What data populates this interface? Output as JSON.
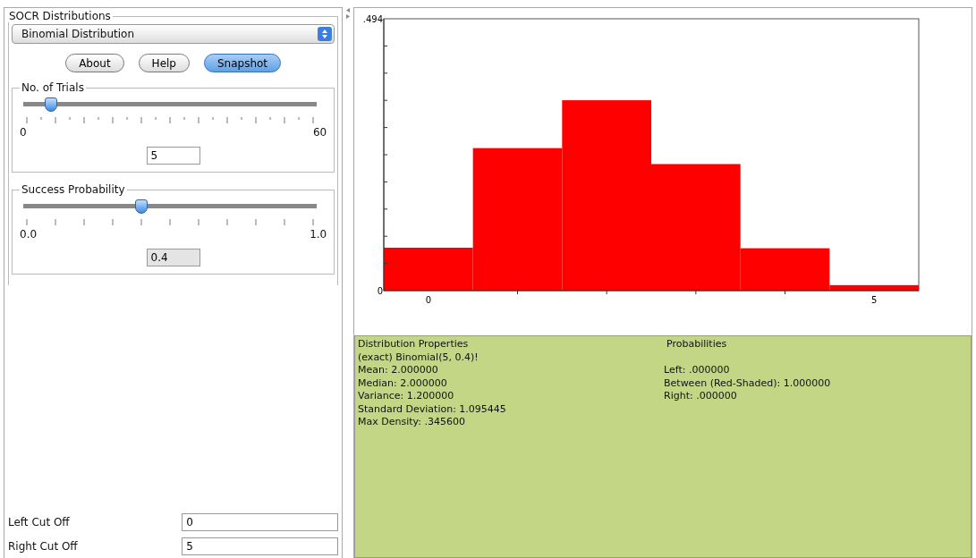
{
  "distributions": {
    "legend": "SOCR Distributions",
    "selected_distribution": "Binomial Distribution"
  },
  "buttons": [
    {
      "label": "About",
      "selected": false
    },
    {
      "label": "Help",
      "selected": false
    },
    {
      "label": "Snapshot",
      "selected": true
    }
  ],
  "sliders": [
    {
      "legend": "No. of Trials",
      "min_label": "0",
      "max_label": "60",
      "level": 0.0833,
      "value": "5"
    },
    {
      "legend": "Success Probability",
      "min_label": "0.0",
      "max_label": "1.0",
      "level": 0.4,
      "value": "0.4"
    }
  ],
  "cutoffs": [
    {
      "label": "Left Cut Off",
      "value": "0"
    },
    {
      "label": "Right Cut Off",
      "value": "5"
    }
  ],
  "chart": {
    "chart_data": {
      "type": "bar",
      "x": [
        0,
        1,
        2,
        3,
        4,
        5
      ],
      "series": [
        {
          "color": "#ff0000",
          "values": [
            0.078,
            0.259,
            0.346,
            0.23,
            0.077,
            0.01
          ]
        }
      ],
      "ylim": [
        0,
        0.494
      ],
      "yticks": [
        0,
        {
          "value": 0.494,
          "label": ".494"
        }
      ],
      "xlim": [
        -0.5,
        5.5
      ],
      "xticks": [
        0,
        5
      ]
    }
  },
  "properties": {
    "title": "Distribution Properties",
    "lines": [
      "(exact) Binomial(5, 0.4)!",
      "Mean: 2.000000",
      "Median: 2.000000",
      "Variance: 1.200000",
      "Standard Deviation: 1.095445",
      "Max Density: .345600"
    ]
  },
  "probabilities": {
    "title": "Probabilities",
    "lines": [
      "Left: .000000",
      "Between (Red-Shaded): 1.000000",
      "Right: .000000"
    ]
  }
}
